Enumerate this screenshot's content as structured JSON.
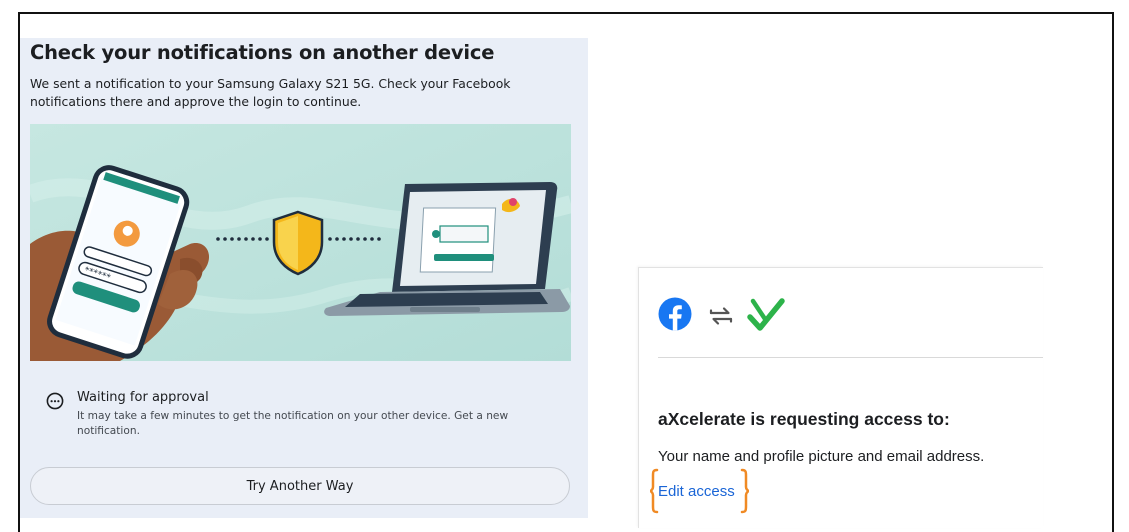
{
  "left_panel": {
    "title": "Check your notifications on another device",
    "description": "We sent a notification to your Samsung Galaxy S21 5G. Check your Facebook notifications there and approve the login to continue.",
    "illustration": {
      "password_mask": "******"
    },
    "waiting": {
      "icon": "more-horizontal-circle-icon",
      "title": "Waiting for approval",
      "description": "It may take a few minutes to get the notification on your other device. Get a new notification."
    },
    "try_another_way_label": "Try Another Way"
  },
  "right_panel": {
    "icons": [
      "facebook-icon",
      "swap-arrows-icon",
      "green-check-icon"
    ],
    "heading": "aXcelerate is requesting access to:",
    "scope_text": "Your name and profile picture and email address.",
    "edit_access_label": "Edit access",
    "annotation_color": "#f08a24"
  },
  "colors": {
    "facebook_blue": "#1877f2",
    "link_blue": "#1a65d6",
    "check_green": "#2db34a",
    "panel_bg": "#e9eef7",
    "illustration_bg": "#bfe3de"
  }
}
